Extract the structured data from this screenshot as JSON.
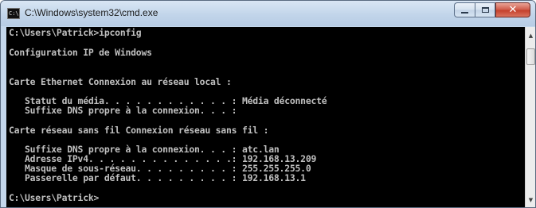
{
  "window": {
    "title": "C:\\Windows\\system32\\cmd.exe",
    "icon_text": "C:\\",
    "close_glyph": "✕"
  },
  "console": {
    "lines": [
      "C:\\Users\\Patrick>ipconfig",
      "Configuration IP de Windows",
      "Carte Ethernet Connexion au réseau local :",
      "   Statut du média. . . . . . . . . . . . : Média déconnecté",
      "   Suffixe DNS propre à la connexion. . . :",
      "Carte réseau sans fil Connexion réseau sans fil :",
      "   Suffixe DNS propre à la connexion. . . : atc.lan",
      "   Adresse IPv4. . . . . . . . . . . . . .: 192.168.13.209",
      "   Masque de sous-réseau. . . . . . . . . : 255.255.255.0",
      "   Passerelle par défaut. . . . . . . . . : 192.168.13.1",
      "C:\\Users\\Patrick>"
    ]
  },
  "scrollbar": {
    "up_glyph": "▲",
    "down_glyph": "▼"
  },
  "colors": {
    "console_background": "#000000",
    "console_text": "#c0c0c0",
    "close_button": "#c5412c",
    "titlebar": "#c2d5ea"
  },
  "icons": [
    "cmd-app-icon",
    "minimize-icon",
    "maximize-icon",
    "close-icon",
    "scroll-up-icon",
    "scroll-down-icon"
  ]
}
